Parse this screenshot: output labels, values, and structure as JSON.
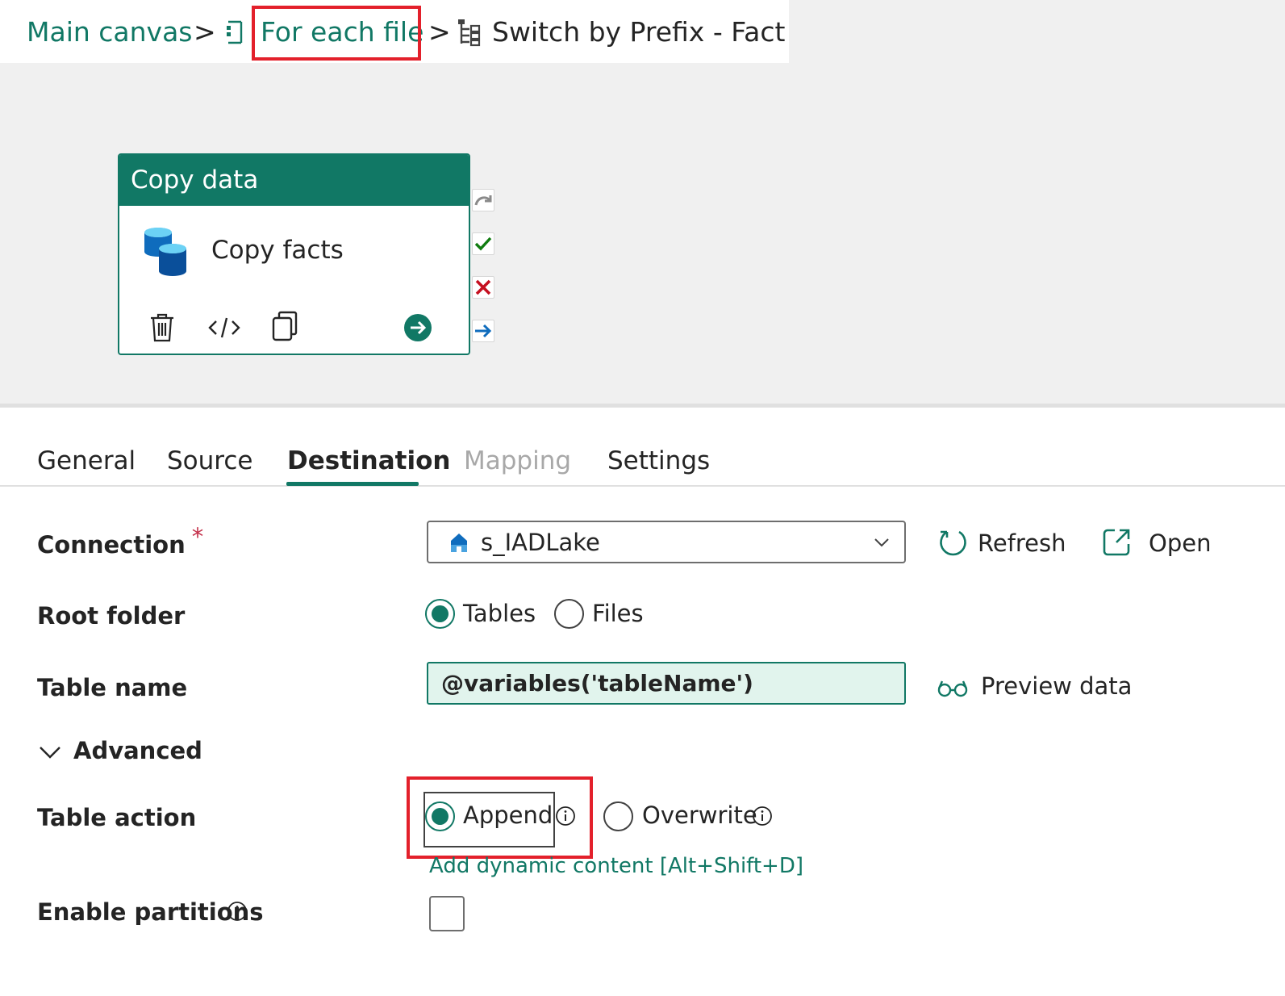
{
  "breadcrumb": {
    "main_canvas": "Main canvas",
    "separator": ">",
    "for_each": "For each file",
    "switch": "Switch by Prefix - Fact"
  },
  "activity": {
    "type": "Copy data",
    "name": "Copy facts",
    "icons": [
      "delete-icon",
      "code-icon",
      "copy-icon",
      "go-icon"
    ],
    "side_icons": [
      "skip-icon",
      "success-icon",
      "fail-icon",
      "completion-icon"
    ]
  },
  "tabs": [
    {
      "label": "General",
      "state": "normal"
    },
    {
      "label": "Source",
      "state": "normal"
    },
    {
      "label": "Destination",
      "state": "active"
    },
    {
      "label": "Mapping",
      "state": "disabled"
    },
    {
      "label": "Settings",
      "state": "normal"
    }
  ],
  "form": {
    "connection": {
      "label": "Connection",
      "required_mark": "*",
      "value": "s_IADLake",
      "refresh": "Refresh",
      "open": "Open"
    },
    "root_folder": {
      "label": "Root folder",
      "options": [
        "Tables",
        "Files"
      ],
      "selected": "Tables"
    },
    "table_name": {
      "label": "Table name",
      "value": "@variables('tableName')",
      "preview": "Preview data"
    },
    "advanced": {
      "label": "Advanced",
      "expanded": true
    },
    "table_action": {
      "label": "Table action",
      "options": [
        "Append",
        "Overwrite"
      ],
      "selected": "Append",
      "dynamic_content": "Add dynamic content [Alt+Shift+D]"
    },
    "enable_partitions": {
      "label": "Enable partitions",
      "checked": false
    }
  },
  "colors": {
    "accent": "#117865",
    "highlight": "#e3202b",
    "expression_bg": "#e1f4ed"
  }
}
